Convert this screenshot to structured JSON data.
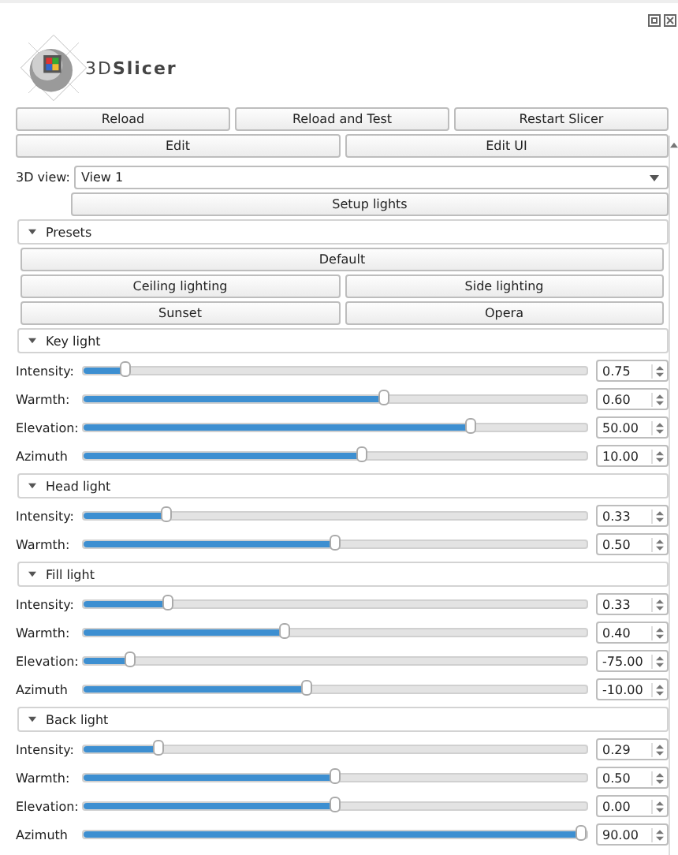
{
  "logo": {
    "text": "3D**Slicer**"
  },
  "dev_buttons": [
    [
      "Reload",
      "Reload and Test",
      "Restart Slicer"
    ],
    [
      "Edit",
      "Edit UI"
    ]
  ],
  "view_select": {
    "label": "3D view:",
    "value": "View 1"
  },
  "setup_button": "Setup lights",
  "sections": [
    {
      "kind": "presets",
      "title": "Presets",
      "expanded": true,
      "rows": [
        [
          "Default"
        ],
        [
          "Ceiling lighting",
          "Side lighting"
        ],
        [
          "Sunset",
          "Opera"
        ]
      ]
    },
    {
      "kind": "sliders",
      "title": "Key light",
      "expanded": true,
      "sliders": [
        {
          "label": "Intensity:",
          "level": 0.085,
          "value": "0.75"
        },
        {
          "label": "Warmth:",
          "level": 0.6,
          "value": "0.60"
        },
        {
          "label": "Elevation:",
          "level": 0.77,
          "value": "50.00"
        },
        {
          "label": "Azimuth",
          "level": 0.555,
          "value": "10.00"
        }
      ]
    },
    {
      "kind": "sliders",
      "title": "Head light",
      "expanded": true,
      "sliders": [
        {
          "label": "Intensity:",
          "level": 0.166,
          "value": "0.33"
        },
        {
          "label": "Warmth:",
          "level": 0.5,
          "value": "0.50"
        }
      ]
    },
    {
      "kind": "sliders",
      "title": "Fill light",
      "expanded": true,
      "sliders": [
        {
          "label": "Intensity:",
          "level": 0.17,
          "value": "0.33"
        },
        {
          "label": "Warmth:",
          "level": 0.4,
          "value": "0.40"
        },
        {
          "label": "Elevation:",
          "level": 0.095,
          "value": "-75.00"
        },
        {
          "label": "Azimuth",
          "level": 0.445,
          "value": "-10.00"
        }
      ]
    },
    {
      "kind": "sliders",
      "title": "Back light",
      "expanded": true,
      "sliders": [
        {
          "label": "Intensity:",
          "level": 0.15,
          "value": "0.29"
        },
        {
          "label": "Warmth:",
          "level": 0.5,
          "value": "0.50"
        },
        {
          "label": "Elevation:",
          "level": 0.5,
          "value": "0.00"
        },
        {
          "label": "Azimuth",
          "level": 0.99,
          "value": "90.00"
        }
      ]
    }
  ]
}
